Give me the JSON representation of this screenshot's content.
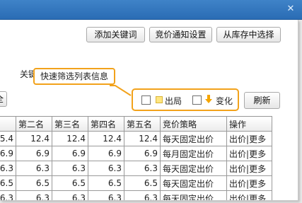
{
  "window": {
    "close_glyph": "✕"
  },
  "toolbar": {
    "add_keyword": "添加关键词",
    "bid_notify": "竞价通知设置",
    "select_from_library": "从库存中选择"
  },
  "keyword_label_partial": "关键",
  "tooltip": "快速筛选列表信息",
  "left_partial_button": "全",
  "filters": {
    "out_label": "出局",
    "change_label": "变化",
    "out_chip_color": "#ffe680",
    "change_arrow_color": "#f5a500",
    "highlight_color": "#f2a21b"
  },
  "refresh_button": "刷新",
  "table": {
    "headers": [
      "",
      "第二名",
      "第三名",
      "第四名",
      "第五名",
      "竞价策略",
      "操作"
    ],
    "rows": [
      {
        "c0": "5.4",
        "c1": "12.4",
        "c2": "12.4",
        "c3": "12.4",
        "c4": "12.4",
        "strategy": "每天固定出价",
        "op_bid": "出价",
        "op_sep": "|",
        "op_more": "更多"
      },
      {
        "c0": "6.9",
        "c1": "6.9",
        "c2": "6.9",
        "c3": "6.9",
        "c4": "6.9",
        "strategy": "每月固定出价",
        "op_bid": "出价",
        "op_sep": "|",
        "op_more": "更多"
      },
      {
        "c0": "6.3",
        "c1": "6.3",
        "c2": "6.3",
        "c3": "6.3",
        "c4": "6.3",
        "strategy": "每天固定出价",
        "op_bid": "出价",
        "op_sep": "|",
        "op_more": "更多"
      },
      {
        "c0": "6.5",
        "c1": "6.5",
        "c2": "6.5",
        "c3": "6.5",
        "c4": "6.5",
        "strategy": "每天固定出价",
        "op_bid": "出价",
        "op_sep": "|",
        "op_more": "更多"
      },
      {
        "c0": "6.3",
        "c1": "6.3",
        "c2": "6.3",
        "c3": "6.3",
        "c4": "6.3",
        "strategy": "每天固定出价",
        "op_bid": "出价",
        "op_sep": "|",
        "op_more": "更多"
      }
    ]
  }
}
